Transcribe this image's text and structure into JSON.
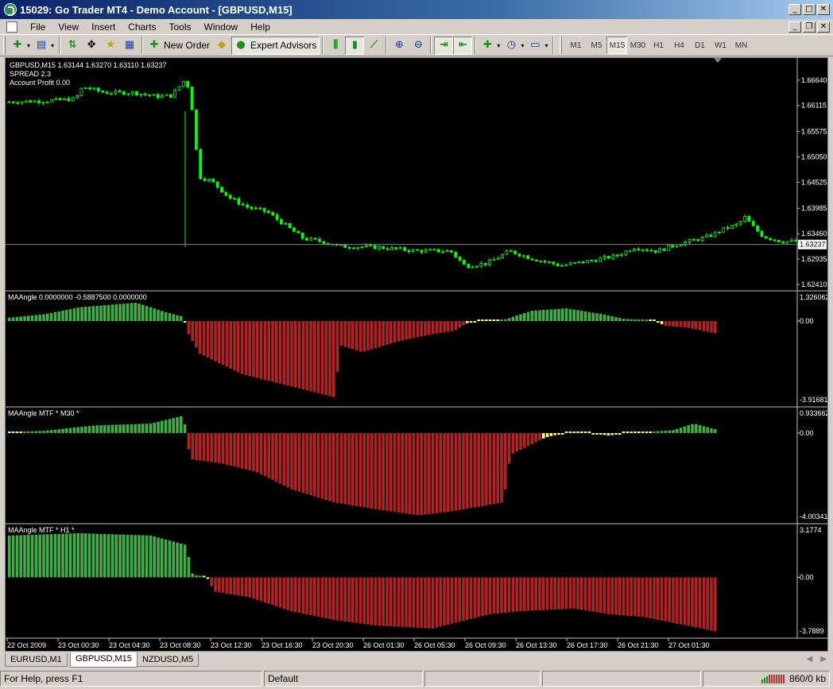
{
  "window": {
    "title": "15029: Go Trader MT4 - Demo Account - [GBPUSD,M15]",
    "buttons": {
      "minimize": "_",
      "maximize": "□",
      "close": "✕",
      "restore": "❐"
    }
  },
  "menu": [
    "File",
    "View",
    "Insert",
    "Charts",
    "Tools",
    "Window",
    "Help"
  ],
  "toolbar": {
    "new_order": "New Order",
    "expert_advisors": "Expert Advisors",
    "timeframes": [
      "M1",
      "M5",
      "M15",
      "M30",
      "H1",
      "H4",
      "D1",
      "W1",
      "MN"
    ],
    "active_timeframe": "M15"
  },
  "chart": {
    "header_line1": "GBPUSD,M15  1.63144 1.63270 1.63110 1.63237",
    "header_line2": "SPREAD 2.3",
    "header_line3": "Account Profit 0.00",
    "current_price": "1.63237",
    "price_axis": [
      "1.66640",
      "1.66115",
      "1.65575",
      "1.65050",
      "1.64525",
      "1.63985",
      "1.63460",
      "1.62935",
      "1.62410"
    ],
    "time_axis": [
      "22 Oct 2009",
      "23 Oct 00:30",
      "23 Oct 04:30",
      "23 Oct 08:30",
      "23 Oct 12:30",
      "23 Oct 16:30",
      "23 Oct 20:30",
      "26 Oct 01:30",
      "26 Oct 05:30",
      "26 Oct 09:30",
      "26 Oct 13:30",
      "26 Oct 17:30",
      "26 Oct 21:30",
      "27 Oct 01:30"
    ],
    "colors": {
      "candle": "#00ff00",
      "bull": "#3cb043",
      "bear": "#b22222",
      "neutral": "#ffff66",
      "grid": "#c0c0c0",
      "price_line": "#808080"
    },
    "indicators": [
      {
        "label": "MAAngle 0.0000000 -0.5887500 0.0000000",
        "top_label": "1.326062",
        "zero_label": "0.00",
        "bottom_label": "-3.91681"
      },
      {
        "label": "MAAngle MTF * M30 *",
        "top_label": "0.933662",
        "zero_label": "0.00",
        "bottom_label": "-4.00341"
      },
      {
        "label": "MAAngle MTF * H1 *",
        "top_label": "3.1774",
        "zero_label": "0.00",
        "bottom_label": "-3.7889"
      }
    ]
  },
  "tabs": [
    "EURUSD,M1",
    "GBPUSD,M15",
    "NZDUSD,M5"
  ],
  "active_tab": "GBPUSD,M15",
  "status": {
    "help": "For Help, press F1",
    "profile": "Default",
    "traffic": "860/0 kb"
  }
}
